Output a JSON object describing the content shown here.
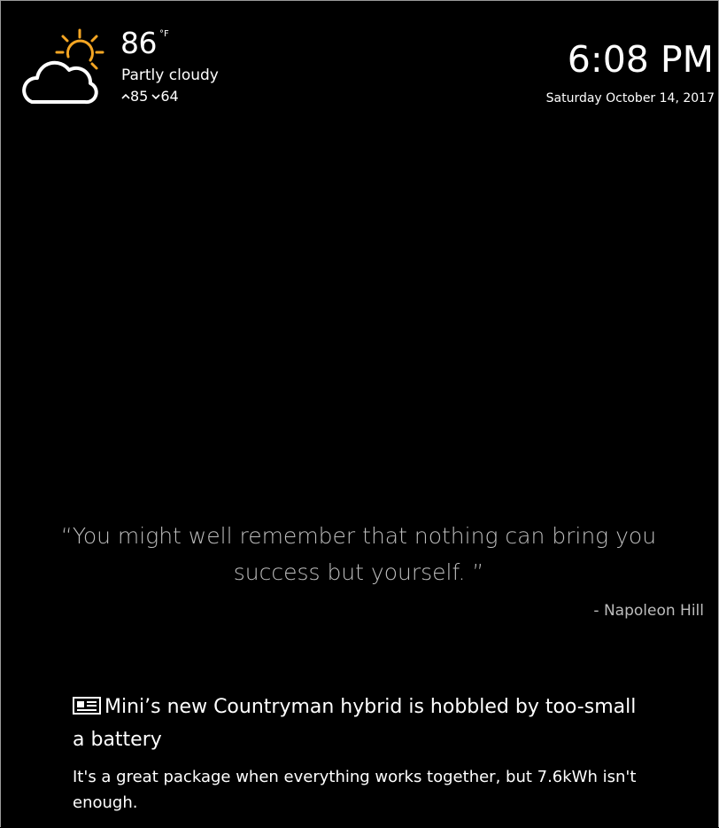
{
  "weather": {
    "icon": "partly-cloudy-icon",
    "temperature": "86",
    "unit": "°F",
    "condition": "Partly cloudy",
    "high": "85",
    "low": "64",
    "colors": {
      "sun": "#f5a623",
      "cloud": "#ffffff"
    }
  },
  "clock": {
    "time": "6:08 PM",
    "date": "Saturday October 14, 2017"
  },
  "quote": {
    "text": "“You might well remember that nothing can bring you success but yourself. ”",
    "author": "- Napoleon Hill"
  },
  "news": {
    "icon": "newspaper-icon",
    "headline": "Mini’s new Countryman hybrid is hobbled by too-small a battery",
    "description": "It's a great package when everything works together, but 7.6kWh isn't enough."
  }
}
